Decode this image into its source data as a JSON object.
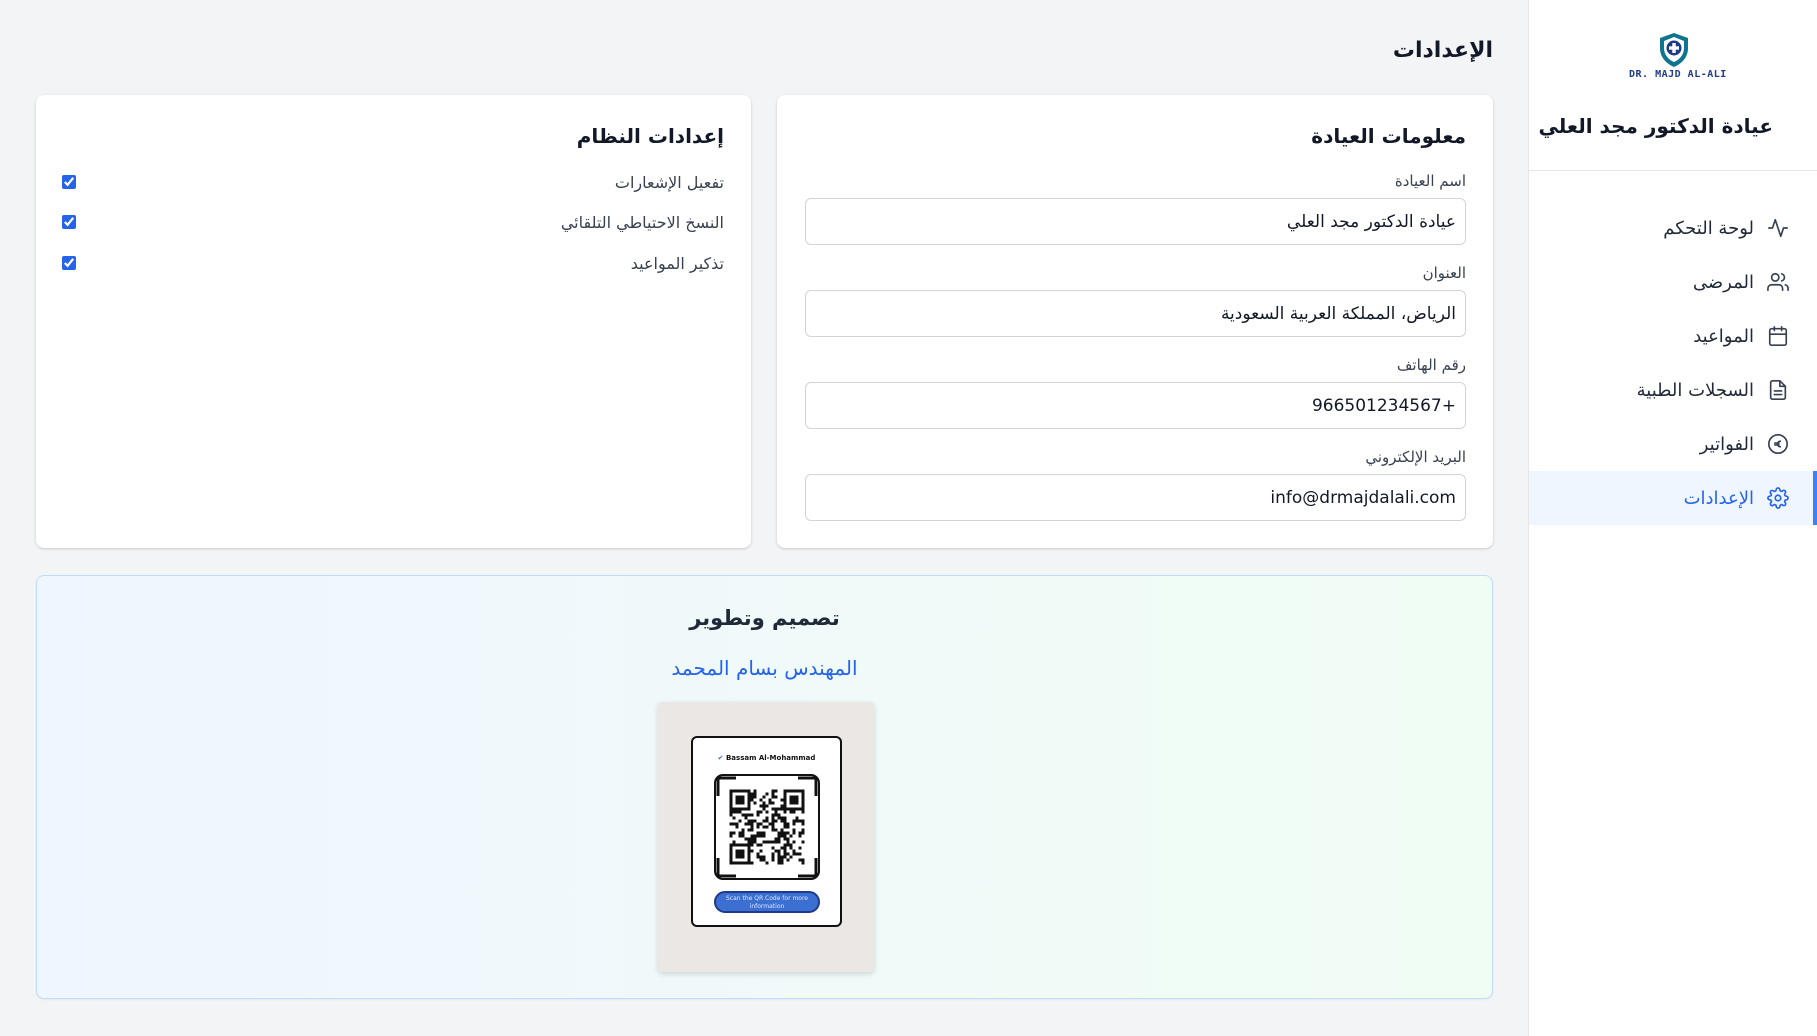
{
  "sidebar": {
    "logo_text": "DR. MAJD AL-ALI",
    "clinic_name": "عيادة الدكتور مجد العلي",
    "items": [
      {
        "label": "لوحة التحكم",
        "icon": "activity-icon"
      },
      {
        "label": "المرضى",
        "icon": "users-icon"
      },
      {
        "label": "المواعيد",
        "icon": "calendar-icon"
      },
      {
        "label": "السجلات الطبية",
        "icon": "file-text-icon"
      },
      {
        "label": "الفواتير",
        "icon": "coin-icon"
      },
      {
        "label": "الإعدادات",
        "icon": "gear-icon",
        "active": true
      }
    ]
  },
  "page": {
    "title": "الإعدادات"
  },
  "clinic_info": {
    "title": "معلومات العيادة",
    "fields": [
      {
        "label": "اسم العيادة",
        "value": "عيادة الدكتور مجد العلي"
      },
      {
        "label": "العنوان",
        "value": "الرياض، المملكة العربية السعودية"
      },
      {
        "label": "رقم الهاتف",
        "value": "+966501234567"
      },
      {
        "label": "البريد الإلكتروني",
        "value": "info@drmajdalali.com"
      }
    ]
  },
  "system_settings": {
    "title": "إعدادات النظام",
    "options": [
      {
        "label": "تفعيل الإشعارات",
        "checked": true
      },
      {
        "label": "النسخ الاحتياطي التلقائي",
        "checked": true
      },
      {
        "label": "تذكير المواعيد",
        "checked": true
      }
    ]
  },
  "credits": {
    "title": "تصميم وتطوير",
    "developer": "المهندس بسام المحمد",
    "qr_name": "Bassam Al-Mohammad",
    "qr_caption": "Scan the QR Code for more information"
  },
  "colors": {
    "accent": "#2563eb",
    "active_bg": "#eff6ff",
    "background": "#f3f4f6",
    "logo_teal": "#0e7490",
    "logo_navy": "#1e3a8a"
  }
}
